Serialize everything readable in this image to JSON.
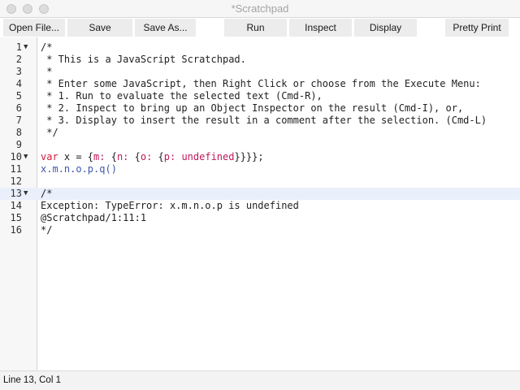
{
  "window": {
    "title": "*Scratchpad"
  },
  "toolbar": {
    "open_file": "Open File...",
    "save": "Save",
    "save_as": "Save As...",
    "run": "Run",
    "inspect": "Inspect",
    "display": "Display",
    "pretty_print": "Pretty Print"
  },
  "editor": {
    "lines": [
      {
        "num": "1",
        "text": "/*"
      },
      {
        "num": "2",
        "text": " * This is a JavaScript Scratchpad."
      },
      {
        "num": "3",
        "text": " *"
      },
      {
        "num": "4",
        "text": " * Enter some JavaScript, then Right Click or choose from the Execute Menu:"
      },
      {
        "num": "5",
        "text": " * 1. Run to evaluate the selected text (Cmd-R),"
      },
      {
        "num": "6",
        "text": " * 2. Inspect to bring up an Object Inspector on the result (Cmd-I), or,"
      },
      {
        "num": "7",
        "text": " * 3. Display to insert the result in a comment after the selection. (Cmd-L)"
      },
      {
        "num": "8",
        "text": " */"
      },
      {
        "num": "9",
        "text": ""
      },
      {
        "num": "10",
        "tokens": [
          "var",
          " x = {",
          "m:",
          " {",
          "n:",
          " {",
          "o:",
          " {",
          "p:",
          " ",
          "undefined",
          "}}}};"
        ]
      },
      {
        "num": "11",
        "text": "x.m.n.o.p.q()"
      },
      {
        "num": "12",
        "text": ""
      },
      {
        "num": "13",
        "text": "/*"
      },
      {
        "num": "14",
        "text": "Exception: TypeError: x.m.n.o.p is undefined"
      },
      {
        "num": "15",
        "text": "@Scratchpad/1:11:1"
      },
      {
        "num": "16",
        "text": "*/"
      }
    ],
    "fold_marker": "▼"
  },
  "status": {
    "position": "Line 13, Col 1"
  },
  "colors": {
    "keyword": "#d0183c",
    "property": "#c0175a",
    "active_line": "#e9f0fb"
  }
}
